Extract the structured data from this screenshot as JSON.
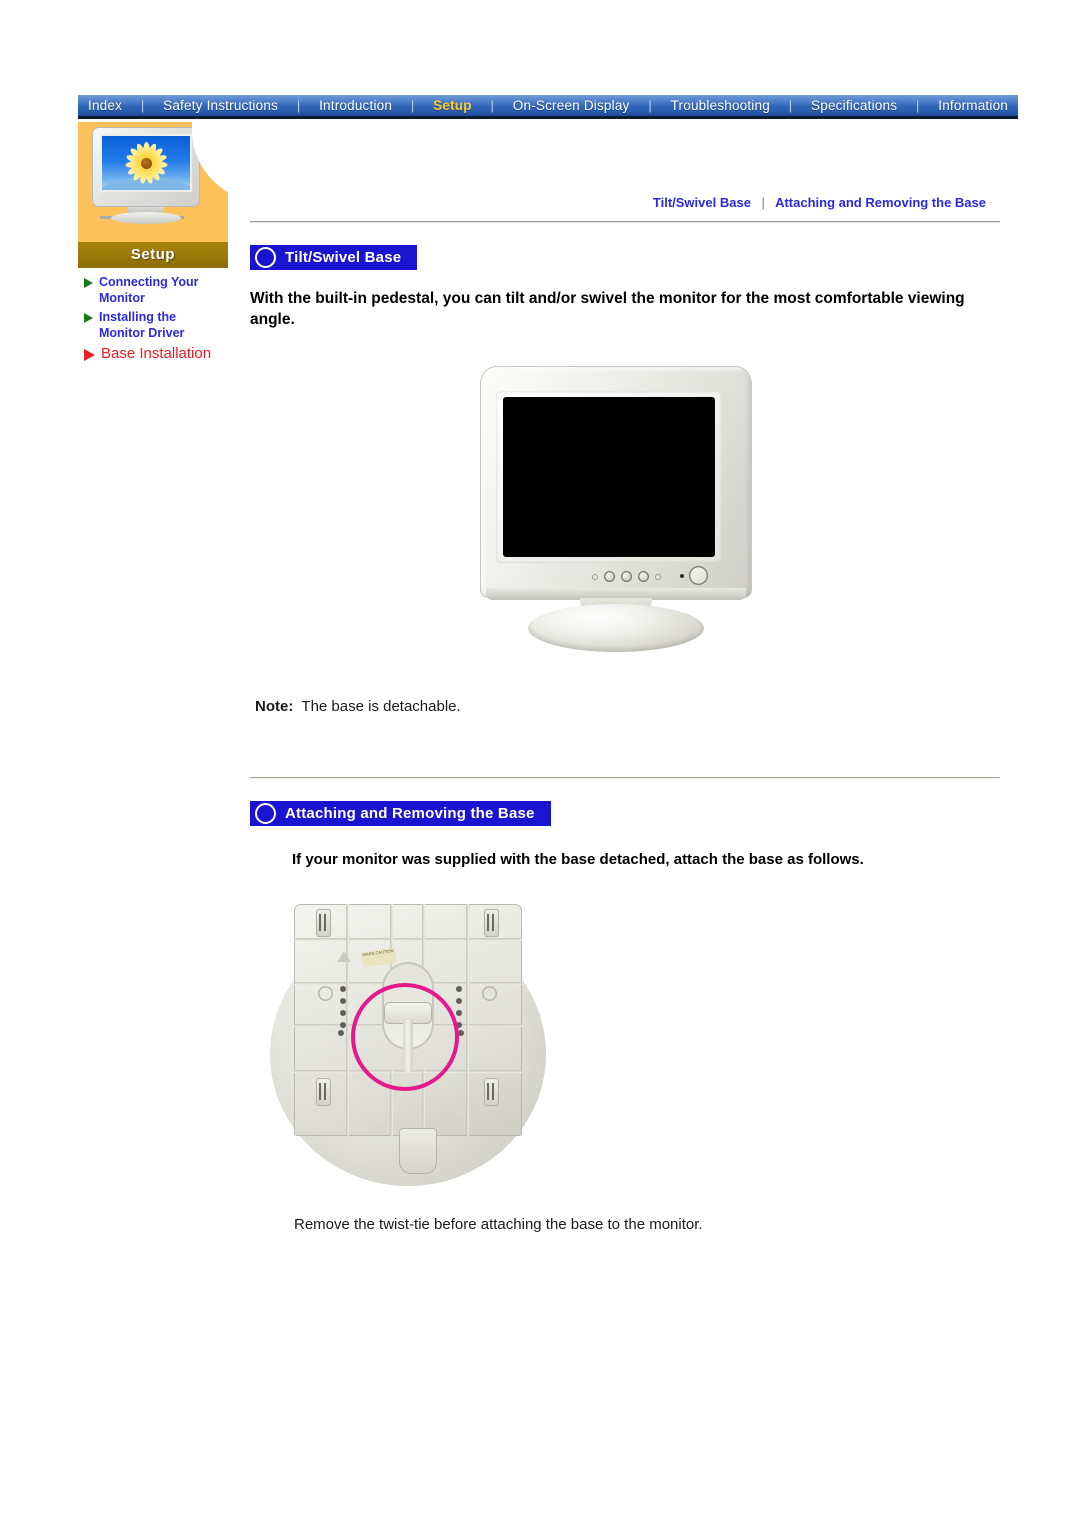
{
  "navbar": {
    "items": [
      {
        "label": "Index",
        "active": false
      },
      {
        "label": "Safety Instructions",
        "active": false
      },
      {
        "label": "Introduction",
        "active": false
      },
      {
        "label": "Setup",
        "active": true
      },
      {
        "label": "On-Screen Display",
        "active": false
      },
      {
        "label": "Troubleshooting",
        "active": false
      },
      {
        "label": "Specifications",
        "active": false
      },
      {
        "label": "Information",
        "active": false
      }
    ],
    "separator": "|"
  },
  "sidebar": {
    "section_label": "Setup",
    "thumbnail_icon": "monitor-with-sunflower-image",
    "items": [
      {
        "label": "Connecting Your Monitor",
        "active": false,
        "marker": "green-triangle-icon"
      },
      {
        "label": "Installing the Monitor Driver",
        "active": false,
        "marker": "green-triangle-icon"
      },
      {
        "label": "Base Installation",
        "active": true,
        "marker": "red-triangle-icon"
      }
    ]
  },
  "breadcrumb": {
    "items": [
      "Tilt/Swivel Base",
      "Attaching and Removing the Base"
    ],
    "separator": "|"
  },
  "sections": [
    {
      "title": "Tilt/Swivel Base",
      "body": "With the built-in pedestal, you can tilt and/or swivel the monitor for the most comfortable viewing angle.",
      "figure": "crt-monitor-front-view",
      "note_label": "Note:",
      "note_text": "The base is detachable."
    },
    {
      "title": "Attaching and Removing the Base",
      "body": "If your monitor was supplied with the base detached, attach the base as follows.",
      "figure": "monitor-base-underside-photo",
      "caption": "Remove the twist-tie before attaching the base to the monitor."
    }
  ],
  "colors": {
    "nav_background": "#2f64b5",
    "nav_active_text": "#ffcc33",
    "sidebar_panel": "#fcc158",
    "setup_bar": "#9c7a09",
    "link_blue": "#2a2ae0",
    "active_red": "#ee1b22",
    "section_header": "#1a13cf",
    "highlight_magenta": "#e6198c"
  },
  "base_photo": {
    "sticker_text": "WARN\nCAUTION"
  }
}
